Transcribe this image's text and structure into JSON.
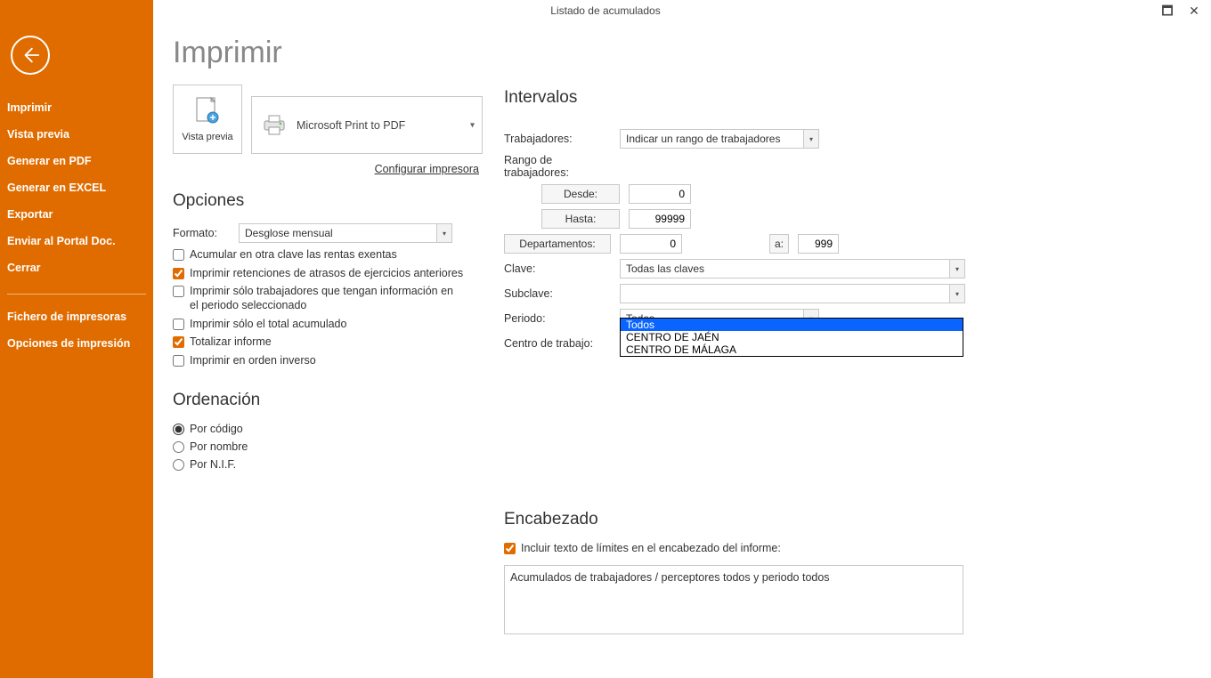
{
  "window": {
    "title": "Listado de acumulados"
  },
  "sidebar": {
    "items": [
      "Imprimir",
      "Vista previa",
      "Generar en PDF",
      "Generar en EXCEL",
      "Exportar",
      "Enviar al Portal Doc.",
      "Cerrar"
    ],
    "items2": [
      "Fichero de impresoras",
      "Opciones de impresión"
    ]
  },
  "page_title": "Imprimir",
  "vista_previa_label": "Vista previa",
  "printer": "Microsoft Print to PDF",
  "config_printer": "Configurar impresora",
  "sections": {
    "opciones": "Opciones",
    "ordenacion": "Ordenación",
    "intervalos": "Intervalos",
    "encabezado": "Encabezado"
  },
  "opciones": {
    "formato_label": "Formato:",
    "formato_value": "Desglose mensual",
    "chk1": "Acumular en otra clave las rentas exentas",
    "chk2": "Imprimir retenciones de atrasos de ejercicios anteriores",
    "chk3": "Imprimir sólo trabajadores que tengan información en el periodo seleccionado",
    "chk4": "Imprimir sólo el total acumulado",
    "chk5": "Totalizar informe",
    "chk6": "Imprimir en orden inverso"
  },
  "ordenacion": {
    "r1": "Por código",
    "r2": "Por nombre",
    "r3": "Por N.I.F."
  },
  "intervalos": {
    "trabajadores_label": "Trabajadores:",
    "trabajadores_value": "Indicar un rango de trabajadores",
    "rango_label": "Rango de trabajadores:",
    "desde_label": "Desde:",
    "desde_value": "0",
    "hasta_label": "Hasta:",
    "hasta_value": "99999",
    "departamentos_label": "Departamentos:",
    "dept_from": "0",
    "dept_a_label": "a:",
    "dept_to": "999",
    "clave_label": "Clave:",
    "clave_value": "Todas las claves",
    "subclave_label": "Subclave:",
    "subclave_value": "",
    "periodo_label": "Periodo:",
    "periodo_value": "Todos",
    "centro_label": "Centro de trabajo:",
    "centro_value": "Todos",
    "centro_options": [
      "Todos",
      "CENTRO DE JAÉN",
      "CENTRO DE MÁLAGA"
    ]
  },
  "encabezado": {
    "chk": "Incluir texto de límites en el encabezado del informe:",
    "text": "Acumulados de trabajadores / perceptores todos y periodo todos"
  }
}
